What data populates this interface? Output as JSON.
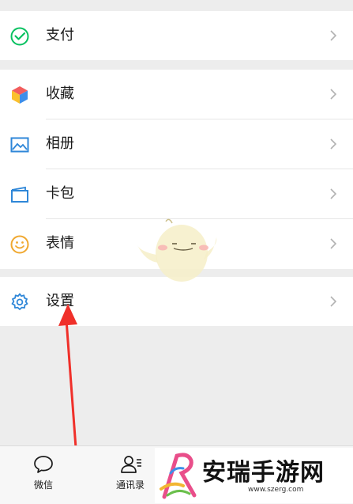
{
  "menu_top": [
    {
      "label": "支付",
      "icon": "wechat-pay-icon"
    }
  ],
  "menu_middle": [
    {
      "label": "收藏",
      "icon": "favorites-cube-icon"
    },
    {
      "label": "相册",
      "icon": "album-icon"
    },
    {
      "label": "卡包",
      "icon": "card-wallet-icon"
    },
    {
      "label": "表情",
      "icon": "sticker-smile-icon"
    }
  ],
  "menu_settings": [
    {
      "label": "设置",
      "icon": "gear-icon"
    }
  ],
  "tabbar": [
    {
      "label": "微信",
      "icon": "chat-bubble-icon"
    },
    {
      "label": "通讯录",
      "icon": "contacts-icon"
    }
  ],
  "watermark": {
    "title": "安瑞手游网",
    "url": "www.szerg.com"
  },
  "colors": {
    "background": "#ededed",
    "wechat_green": "#07c160",
    "arrow_red": "#f0302a"
  }
}
